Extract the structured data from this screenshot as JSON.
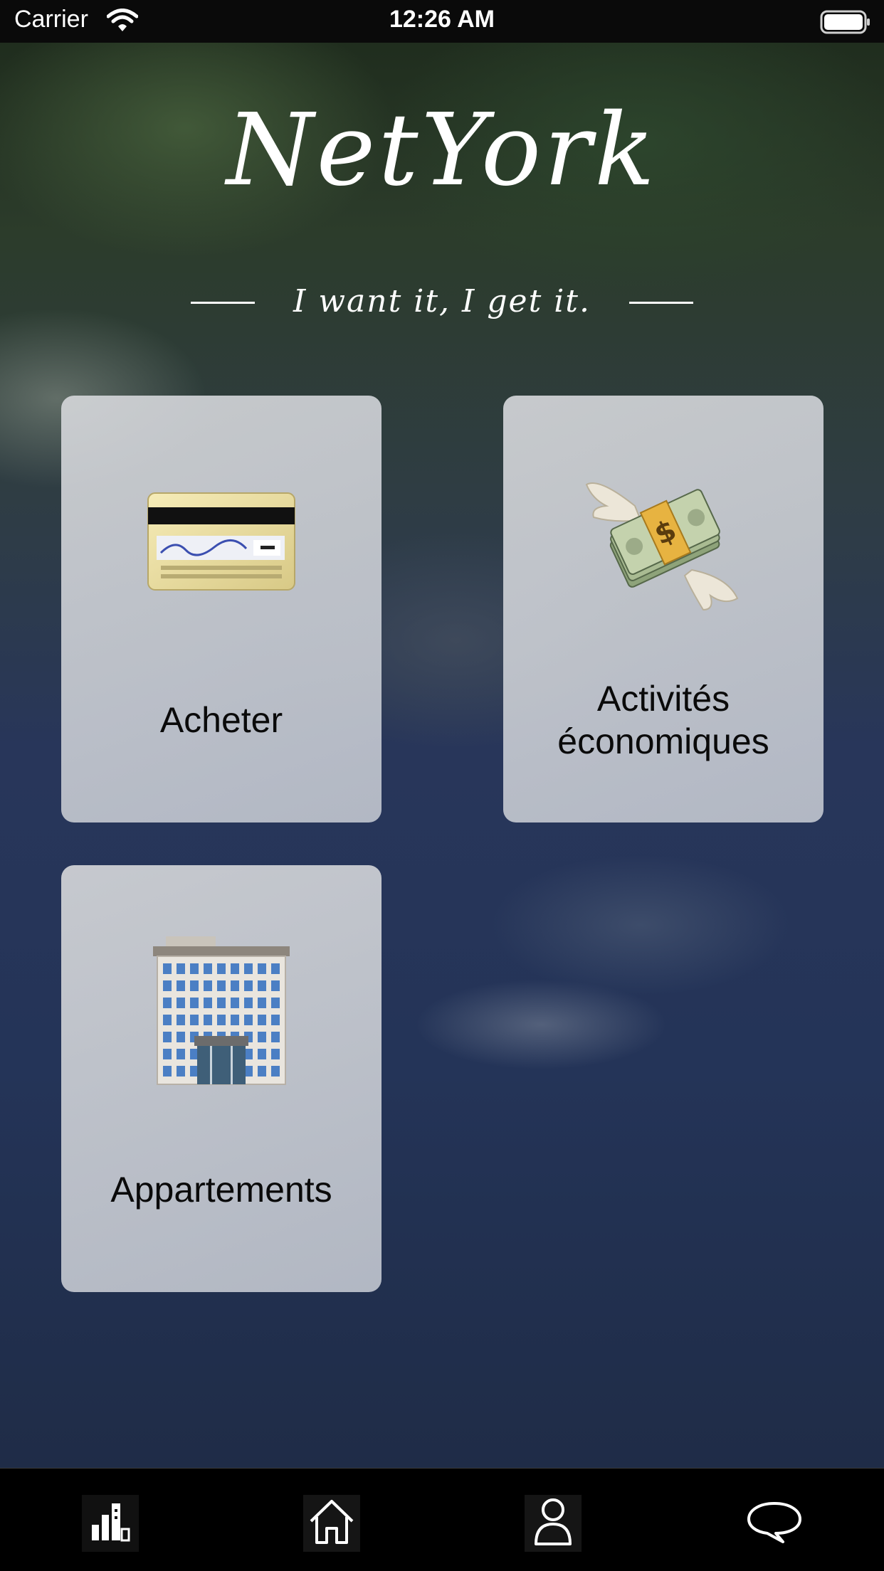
{
  "status_bar": {
    "carrier": "Carrier",
    "time": "12:26 AM",
    "icons": [
      "wifi-icon",
      "battery-icon"
    ]
  },
  "header": {
    "title": "NetYork",
    "tagline": "I want it, I get it."
  },
  "cards": [
    {
      "label": "Acheter",
      "icon": "credit-card-icon"
    },
    {
      "label_line1": "Activités",
      "label_line2": "économiques",
      "icon": "money-with-wings-icon"
    },
    {
      "label": "Appartements",
      "icon": "office-building-icon"
    }
  ],
  "tab_bar": {
    "tabs": [
      {
        "icon": "buildings-chart-icon"
      },
      {
        "icon": "home-icon"
      },
      {
        "icon": "person-icon"
      },
      {
        "icon": "chat-bubble-icon"
      }
    ]
  },
  "colors": {
    "status_bar": "#0a0a0a",
    "card_background": "#d2d4d7",
    "tab_bar": "#000000",
    "text_on_dark": "#ffffff",
    "card_text": "#0a0a0a"
  }
}
